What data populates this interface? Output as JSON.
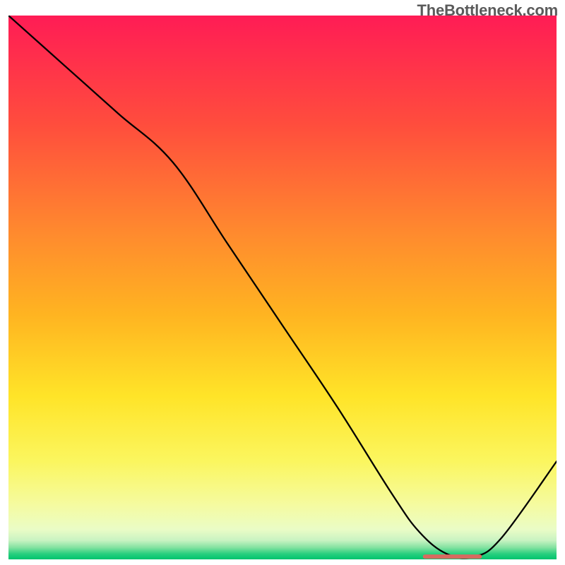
{
  "watermark": "TheBottleneck.com",
  "chart_data": {
    "type": "line",
    "title": "",
    "xlabel": "",
    "ylabel": "",
    "xlim": [
      0,
      100
    ],
    "ylim": [
      0,
      100
    ],
    "x": [
      0,
      10,
      20,
      30,
      40,
      50,
      60,
      70,
      75,
      80,
      85,
      90,
      100
    ],
    "y": [
      100,
      91,
      82,
      73,
      58,
      43,
      28,
      12,
      5,
      1,
      0.5,
      4,
      18
    ],
    "marker_segment_x": [
      76,
      86
    ],
    "flat_zone_y": 0.5,
    "gradient_stops": [
      {
        "offset": 0.0,
        "color": "#ff1c55"
      },
      {
        "offset": 0.2,
        "color": "#ff4d3d"
      },
      {
        "offset": 0.4,
        "color": "#ff8a2e"
      },
      {
        "offset": 0.55,
        "color": "#ffb421"
      },
      {
        "offset": 0.7,
        "color": "#ffe428"
      },
      {
        "offset": 0.82,
        "color": "#fbf65f"
      },
      {
        "offset": 0.9,
        "color": "#f5fba0"
      },
      {
        "offset": 0.945,
        "color": "#eafcc6"
      },
      {
        "offset": 0.965,
        "color": "#c9f3c2"
      },
      {
        "offset": 0.978,
        "color": "#84e2a1"
      },
      {
        "offset": 0.99,
        "color": "#28cf7e"
      },
      {
        "offset": 1.0,
        "color": "#00c46e"
      }
    ],
    "marker_color": "#d86a60",
    "line_color": "#000000",
    "line_width": 2.3
  }
}
